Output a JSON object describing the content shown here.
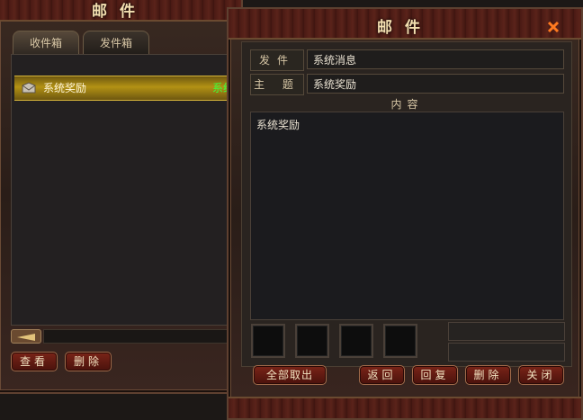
{
  "inbox_window": {
    "title": "邮件",
    "tabs": [
      {
        "label": "收件箱"
      },
      {
        "label": "发件箱"
      }
    ],
    "messages": [
      {
        "title": "系统奖励",
        "sender": "系统"
      }
    ],
    "buttons": {
      "view": "查看",
      "delete": "删除"
    }
  },
  "mail_window": {
    "title": "邮件",
    "sender_label": "发件人",
    "sender_value": "系统消息",
    "subject_label": "主 题",
    "subject_value": "系统奖励",
    "content_label": "内容",
    "content_text": "系统奖励",
    "buttons": {
      "take_all": "全部取出",
      "back": "返回",
      "reply": "回复",
      "delete": "删除",
      "close": "关闭"
    }
  }
}
